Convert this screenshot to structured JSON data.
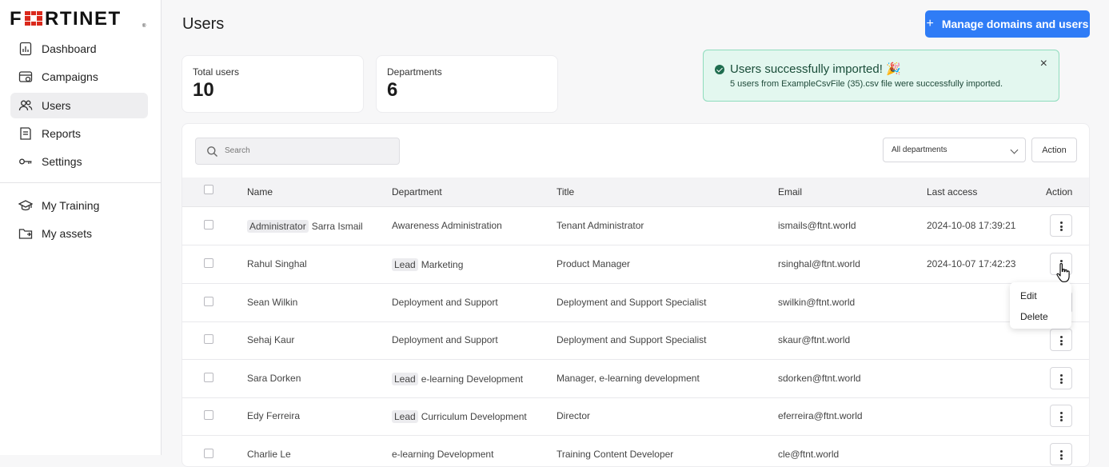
{
  "brand": {
    "logo_text": "FORTINET",
    "accent": "#da291c"
  },
  "sidebar": {
    "items": [
      {
        "label": "Dashboard",
        "icon": "dashboard-icon"
      },
      {
        "label": "Campaigns",
        "icon": "campaigns-icon"
      },
      {
        "label": "Users",
        "icon": "users-icon",
        "active": true
      },
      {
        "label": "Reports",
        "icon": "reports-icon"
      },
      {
        "label": "Settings",
        "icon": "settings-icon"
      }
    ],
    "secondary": [
      {
        "label": "My Training",
        "icon": "graduation-cap-icon"
      },
      {
        "label": "My assets",
        "icon": "folder-icon"
      }
    ]
  },
  "header": {
    "title": "Users",
    "manage_button": "Manage domains and users",
    "manage_plus": "+"
  },
  "stats": {
    "total_users": {
      "label": "Total users",
      "value": "10"
    },
    "departments": {
      "label": "Departments",
      "value": "6"
    }
  },
  "toast": {
    "title": "Users successfully imported! 🎉",
    "body": "5 users from ExampleCsvFile (35).csv file were successfully imported.",
    "close": "×"
  },
  "toolbar": {
    "search_placeholder": "Search",
    "department_filter": "All departments",
    "action_label": "Action"
  },
  "table": {
    "columns": [
      "Name",
      "Department",
      "Title",
      "Email",
      "Last access",
      "Action"
    ],
    "rows": [
      {
        "name_tag": "Administrator",
        "name": "Sarra Ismail",
        "dept_tag": "",
        "department": "Awareness Administration",
        "title": "Tenant Administrator",
        "email": "ismails@ftnt.world",
        "last_access": "2024-10-08 17:39:21"
      },
      {
        "name_tag": "",
        "name": "Rahul Singhal",
        "dept_tag": "Lead",
        "department": "Marketing",
        "title": "Product Manager",
        "email": "rsinghal@ftnt.world",
        "last_access": "2024-10-07 17:42:23"
      },
      {
        "name_tag": "",
        "name": "Sean Wilkin",
        "dept_tag": "",
        "department": "Deployment and Support",
        "title": "Deployment and Support Specialist",
        "email": "swilkin@ftnt.world",
        "last_access": ""
      },
      {
        "name_tag": "",
        "name": "Sehaj Kaur",
        "dept_tag": "",
        "department": "Deployment and Support",
        "title": "Deployment and Support Specialist",
        "email": "skaur@ftnt.world",
        "last_access": ""
      },
      {
        "name_tag": "",
        "name": "Sara Dorken",
        "dept_tag": "Lead",
        "department": "e-learning Development",
        "title": "Manager, e-learning development",
        "email": "sdorken@ftnt.world",
        "last_access": ""
      },
      {
        "name_tag": "",
        "name": "Edy Ferreira",
        "dept_tag": "Lead",
        "department": "Curriculum Development",
        "title": "Director",
        "email": "eferreira@ftnt.world",
        "last_access": ""
      },
      {
        "name_tag": "",
        "name": "Charlie Le",
        "dept_tag": "",
        "department": "e-learning Development",
        "title": "Training Content Developer",
        "email": "cle@ftnt.world",
        "last_access": ""
      }
    ]
  },
  "row_menu": {
    "items": [
      "Edit",
      "Delete"
    ]
  }
}
